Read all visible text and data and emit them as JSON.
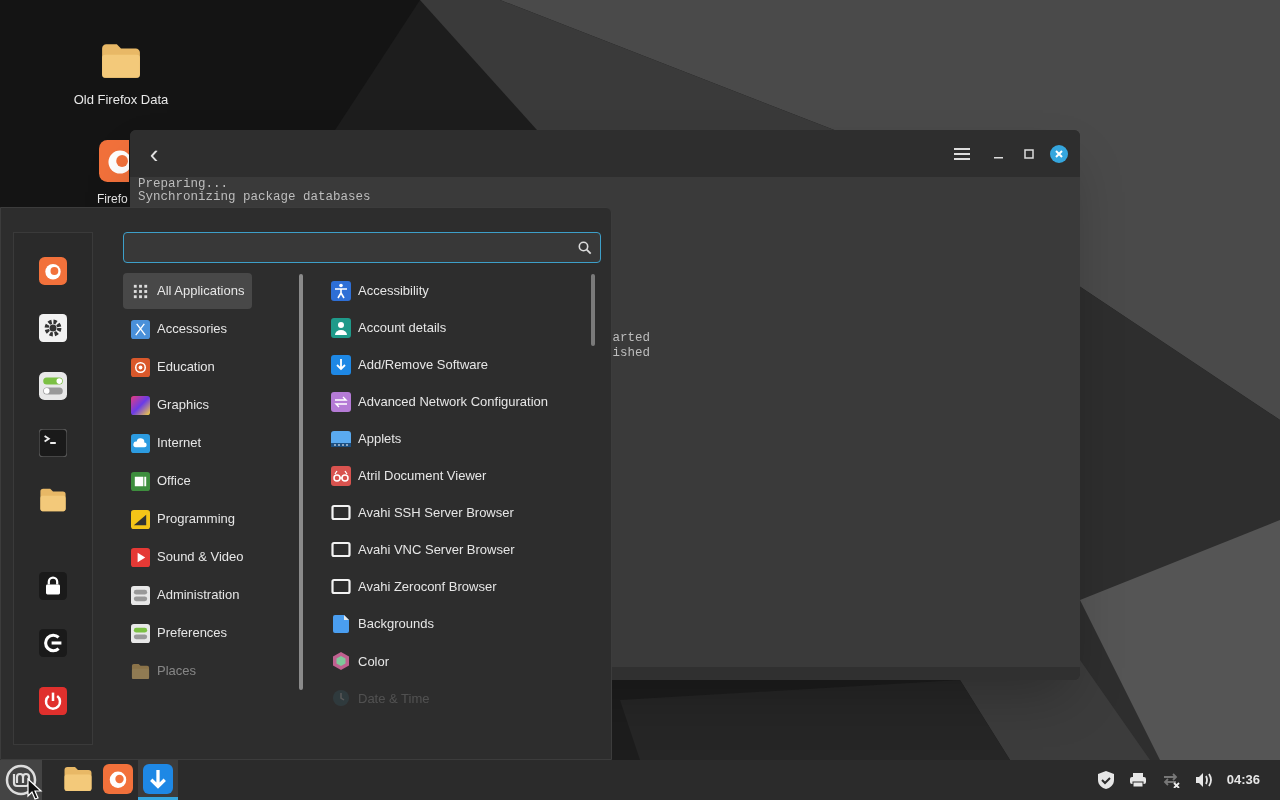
{
  "desktop_icons": [
    {
      "label": "Old Firefox Data"
    },
    {
      "label": "Firefo"
    }
  ],
  "terminal": {
    "back": "‹",
    "lines": [
      "Preparing...",
      "Synchronizing package databases"
    ],
    "fragments": [
      "arted",
      "ished"
    ]
  },
  "menu": {
    "categories": [
      {
        "label": "All Applications",
        "selected": true,
        "faded": false
      },
      {
        "label": "Accessories",
        "selected": false,
        "faded": false
      },
      {
        "label": "Education",
        "selected": false,
        "faded": false
      },
      {
        "label": "Graphics",
        "selected": false,
        "faded": false
      },
      {
        "label": "Internet",
        "selected": false,
        "faded": false
      },
      {
        "label": "Office",
        "selected": false,
        "faded": false
      },
      {
        "label": "Programming",
        "selected": false,
        "faded": false
      },
      {
        "label": "Sound & Video",
        "selected": false,
        "faded": false
      },
      {
        "label": "Administration",
        "selected": false,
        "faded": false
      },
      {
        "label": "Preferences",
        "selected": false,
        "faded": false
      },
      {
        "label": "Places",
        "selected": false,
        "faded": true
      }
    ],
    "apps": [
      {
        "label": "Accessibility",
        "faded": false
      },
      {
        "label": "Account details",
        "faded": false
      },
      {
        "label": "Add/Remove Software",
        "faded": false
      },
      {
        "label": "Advanced Network Configuration",
        "faded": false
      },
      {
        "label": "Applets",
        "faded": false
      },
      {
        "label": "Atril Document Viewer",
        "faded": false
      },
      {
        "label": "Avahi SSH Server Browser",
        "faded": false
      },
      {
        "label": "Avahi VNC Server Browser",
        "faded": false
      },
      {
        "label": "Avahi Zeroconf Browser",
        "faded": false
      },
      {
        "label": "Backgrounds",
        "faded": false
      },
      {
        "label": "Color",
        "faded": false
      },
      {
        "label": "Date & Time",
        "faded": true
      }
    ]
  },
  "taskbar": {
    "clock": "04:36",
    "apps": [
      {
        "selected": false
      },
      {
        "selected": false
      },
      {
        "selected": true
      }
    ]
  }
}
